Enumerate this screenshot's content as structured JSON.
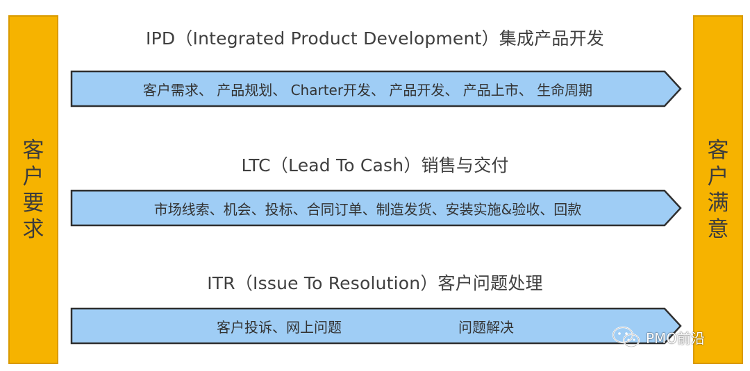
{
  "colors": {
    "pillar_fill": "#f6b300",
    "arrow_fill": "#9fcdf5",
    "arrow_stroke": "#2f2f2f"
  },
  "left_pillar": {
    "label": "客户要求"
  },
  "right_pillar": {
    "label": "客户满意"
  },
  "rows": [
    {
      "title": "IPD（Integrated Product Development）集成产品开发",
      "steps": "客户需求、 产品规划、 Charter开发、 产品开发、 产品上市、 生命周期"
    },
    {
      "title": "LTC（Lead To Cash）销售与交付",
      "steps": "市场线索、机会、投标、合同订单、制造发货、安装实施&验收、回款"
    },
    {
      "title": "ITR（Issue To Resolution）客户问题处理",
      "steps_a": "客户投诉、网上问题",
      "steps_b": "问题解决"
    }
  ],
  "watermark": {
    "icon": "wechat-icon",
    "text": "PMO前沿"
  }
}
